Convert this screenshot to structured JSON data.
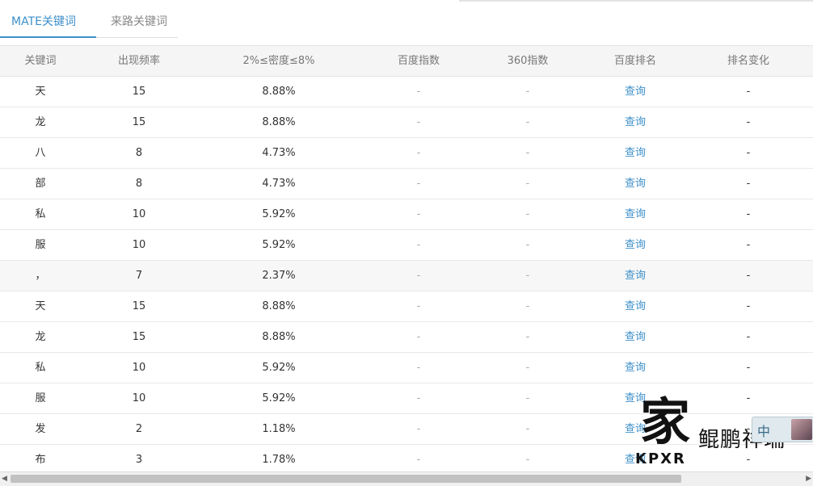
{
  "tabs": [
    {
      "label": "MATE关键词",
      "active": true
    },
    {
      "label": "来路关键词",
      "active": false
    }
  ],
  "table": {
    "headers": [
      "关键词",
      "出现频率",
      "2%≤密度≤8%",
      "百度指数",
      "360指数",
      "百度排名",
      "排名变化"
    ],
    "rows": [
      {
        "keyword": "天",
        "frequency": "15",
        "density": "8.88%",
        "baidu_index": "-",
        "index_360": "-",
        "baidu_rank": "查询",
        "rank_change": "-"
      },
      {
        "keyword": "龙",
        "frequency": "15",
        "density": "8.88%",
        "baidu_index": "-",
        "index_360": "-",
        "baidu_rank": "查询",
        "rank_change": "-"
      },
      {
        "keyword": "八",
        "frequency": "8",
        "density": "4.73%",
        "baidu_index": "-",
        "index_360": "-",
        "baidu_rank": "查询",
        "rank_change": "-"
      },
      {
        "keyword": "部",
        "frequency": "8",
        "density": "4.73%",
        "baidu_index": "-",
        "index_360": "-",
        "baidu_rank": "查询",
        "rank_change": "-"
      },
      {
        "keyword": "私",
        "frequency": "10",
        "density": "5.92%",
        "baidu_index": "-",
        "index_360": "-",
        "baidu_rank": "查询",
        "rank_change": "-"
      },
      {
        "keyword": "服",
        "frequency": "10",
        "density": "5.92%",
        "baidu_index": "-",
        "index_360": "-",
        "baidu_rank": "查询",
        "rank_change": "-"
      },
      {
        "keyword": "，",
        "frequency": "7",
        "density": "2.37%",
        "baidu_index": "-",
        "index_360": "-",
        "baidu_rank": "查询",
        "rank_change": "-"
      },
      {
        "keyword": "天",
        "frequency": "15",
        "density": "8.88%",
        "baidu_index": "-",
        "index_360": "-",
        "baidu_rank": "查询",
        "rank_change": "-"
      },
      {
        "keyword": "龙",
        "frequency": "15",
        "density": "8.88%",
        "baidu_index": "-",
        "index_360": "-",
        "baidu_rank": "查询",
        "rank_change": "-"
      },
      {
        "keyword": "私",
        "frequency": "10",
        "density": "5.92%",
        "baidu_index": "-",
        "index_360": "-",
        "baidu_rank": "查询",
        "rank_change": "-"
      },
      {
        "keyword": "服",
        "frequency": "10",
        "density": "5.92%",
        "baidu_index": "-",
        "index_360": "-",
        "baidu_rank": "查询",
        "rank_change": "-"
      },
      {
        "keyword": "发",
        "frequency": "2",
        "density": "1.18%",
        "baidu_index": "-",
        "index_360": "-",
        "baidu_rank": "查询",
        "rank_change": "-"
      },
      {
        "keyword": "布",
        "frequency": "3",
        "density": "1.78%",
        "baidu_index": "-",
        "index_360": "-",
        "baidu_rank": "查询",
        "rank_change": "-"
      }
    ]
  },
  "watermark": {
    "glyph": "家",
    "text": "鲲鹏祥瑞",
    "latin": "KPXR"
  },
  "ime": {
    "char": "中"
  },
  "colors": {
    "accent": "#3d8fc9",
    "header_bg": "#f5f5f5",
    "border": "#e8e8e8"
  },
  "icons": {
    "scroll_left": "triangle-left",
    "scroll_right": "triangle-right"
  }
}
